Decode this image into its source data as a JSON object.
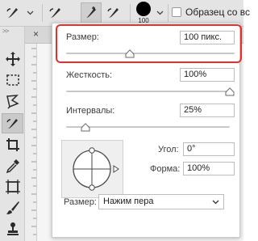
{
  "options_bar": {
    "brush_size_readout": "100",
    "checkbox_label": "Образец со вс"
  },
  "brush_panel": {
    "size_label": "Размер:",
    "size_value": "100 пикс.",
    "size_slider_fraction": 0.38,
    "hardness_label": "Жесткость:",
    "hardness_value": "100%",
    "hardness_slider_fraction": 1.0,
    "spacing_label": "Интервалы:",
    "spacing_value": "25%",
    "spacing_slider_fraction": 0.12,
    "angle_label": "Угол:",
    "angle_value": "0°",
    "roundness_label": "Форма:",
    "roundness_value": "100%",
    "pressure_label": "Размер:",
    "pressure_select_value": "Нажим пера"
  },
  "colors": {
    "highlight": "#e2312a",
    "panel_bg": "#ffffff",
    "chrome_bg": "#e4e4e4"
  }
}
